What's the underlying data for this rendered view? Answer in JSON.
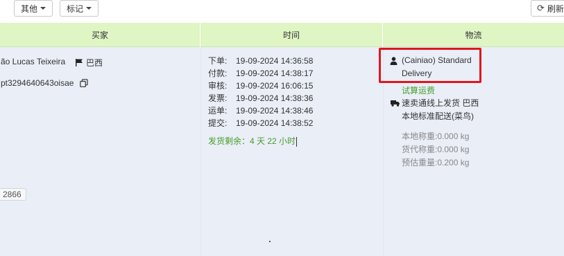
{
  "toolbar": {
    "other_label": "其他",
    "mark_label": "标记",
    "refresh_label": "刷新"
  },
  "table": {
    "headers": {
      "buyer": "买家",
      "time": "时间",
      "logistics": "物流"
    }
  },
  "order": {
    "buyer": {
      "name": "ão Lucas Teixeira",
      "country": "巴西",
      "id": "pt3294640643oisae",
      "tag": "2866"
    },
    "times": [
      {
        "label": "下单:",
        "value": "19-09-2024 14:36:58"
      },
      {
        "label": "付款:",
        "value": "19-09-2024 14:38:17"
      },
      {
        "label": "审核:",
        "value": "19-09-2024 16:06:15"
      },
      {
        "label": "发票:",
        "value": "19-09-2024 14:38:36"
      },
      {
        "label": "运单:",
        "value": "19-09-2024 14:38:46"
      },
      {
        "label": "提交:",
        "value": "19-09-2024 14:38:52"
      }
    ],
    "remaining": "发货剩余：4 天 22 小时",
    "logistics": {
      "carrier_line1": "(Cainiao) Standard",
      "carrier_line2": "Delivery",
      "calc_link": "试算运费",
      "ship_line1": "速卖通线上发货 巴西",
      "ship_line2": "本地标准配送(菜鸟)",
      "weights": {
        "local": "本地称重:0.000 kg",
        "agent": "货代称重:0.000 kg",
        "estimated": "预估重量:0.200 kg"
      }
    }
  },
  "colors": {
    "header_bg": "#dff5c4",
    "row_bg": "#e9eef7",
    "accent_green": "#4a9d2a",
    "highlight_red": "#e0161e"
  },
  "icons": [
    "caret-down-icon",
    "refresh-icon",
    "flag-icon",
    "copy-icon",
    "person-icon",
    "truck-icon"
  ]
}
